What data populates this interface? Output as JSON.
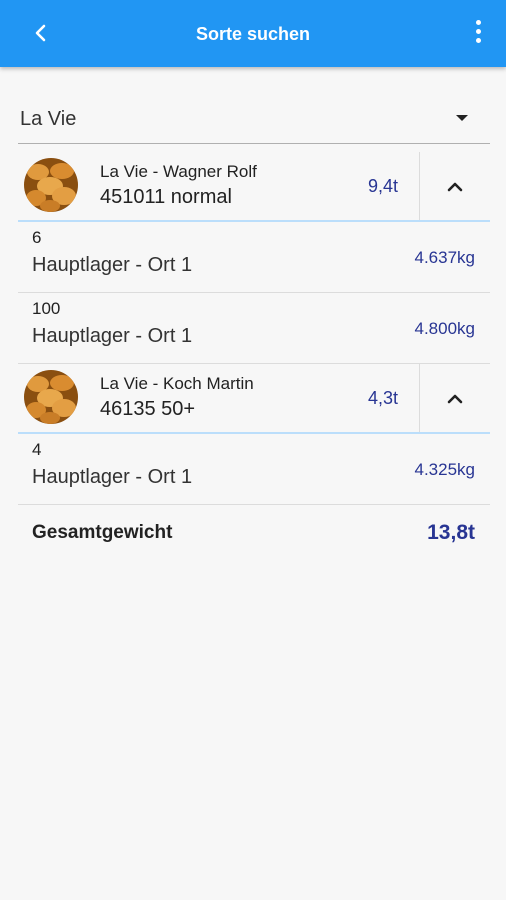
{
  "appbar": {
    "title": "Sorte suchen"
  },
  "filter": {
    "selected": "La Vie"
  },
  "groups": [
    {
      "name": "La Vie - Wagner Rolf",
      "sub": "451011 normal",
      "weight": "9,4t",
      "rows": [
        {
          "num": "6",
          "location": "Hauptlager - Ort 1",
          "weight": "4.637kg"
        },
        {
          "num": "100",
          "location": "Hauptlager - Ort 1",
          "weight": "4.800kg"
        }
      ]
    },
    {
      "name": "La Vie - Koch Martin",
      "sub": "46135 50+",
      "weight": "4,3t",
      "rows": [
        {
          "num": "4",
          "location": "Hauptlager - Ort 1",
          "weight": "4.325kg"
        }
      ]
    }
  ],
  "total": {
    "label": "Gesamtgewicht",
    "value": "13,8t"
  },
  "colors": {
    "appbar": "#2196f3",
    "accent_text": "#283593",
    "divider_accent": "#bbdefb"
  },
  "icons": {
    "back": "back-arrow-icon",
    "menu": "more-vert-icon",
    "expand": "chevron-up-icon",
    "avatar": "potato-image"
  }
}
